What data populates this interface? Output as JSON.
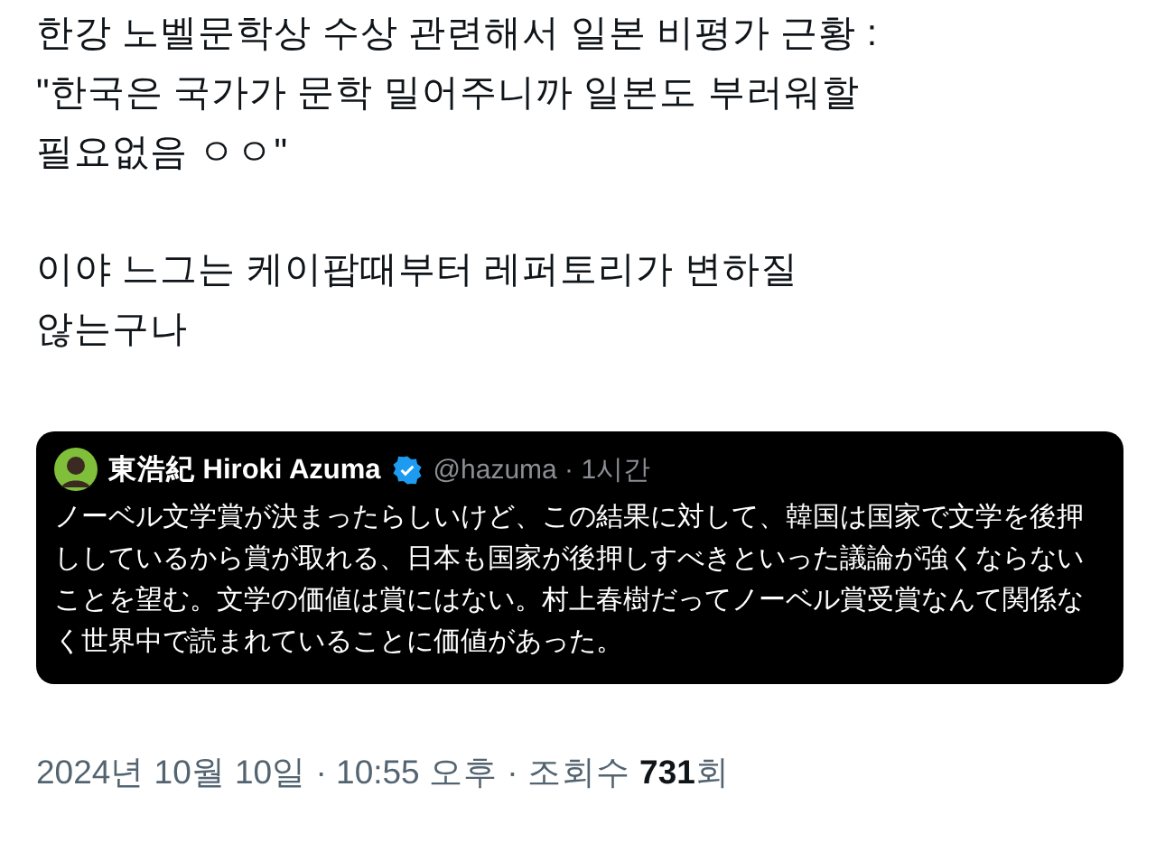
{
  "post": {
    "paragraphs": [
      "한강 노벨문학상 수상 관련해서 일본 비평가 근황 :\n\"한국은 국가가 문학 밀어주니까 일본도 부러워할\n필요없음 ㅇㅇ\"",
      "이야 느그는 케이팝때부터 레퍼토리가 변하질\n않는구나"
    ],
    "quoted": {
      "name": "東浩紀 Hiroki Azuma",
      "verified": true,
      "handle": "@hazuma · 1시간",
      "text": "ノーベル文学賞が決まったらしいけど、この結果に対して、韓国は国家で文学を後押ししているから賞が取れる、日本も国家が後押しすべきといった議論が強くならないことを望む。文学の価値は賞にはない。村上春樹だってノーベル賞受賞なんて関係なく世界中で読まれていることに価値があった。"
    },
    "meta": "2024년 10월 10일 · 10:55 오후 · 조회수 **731**회"
  }
}
